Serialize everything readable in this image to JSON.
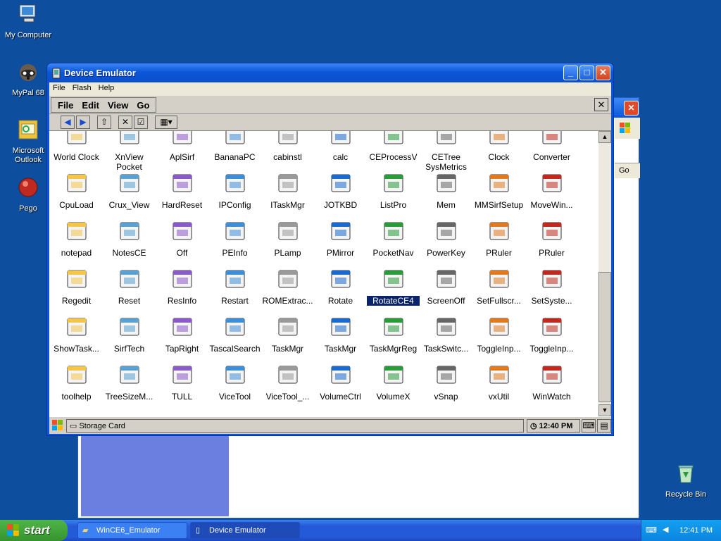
{
  "desktop": {
    "icons": [
      {
        "label": "My Computer"
      },
      {
        "label": "MyPal 68"
      },
      {
        "label": "Microsoft Outlook"
      },
      {
        "label": "Pego"
      },
      {
        "label": "Recycle Bin"
      }
    ]
  },
  "bg_window": {
    "tab_text": "Go"
  },
  "window": {
    "title": "Device Emulator",
    "menu": [
      "File",
      "Flash",
      "Help"
    ],
    "buttons": {
      "minimize": "_",
      "maximize": "□",
      "close": "✕"
    }
  },
  "device": {
    "menu": [
      "File",
      "Edit",
      "View",
      "Go"
    ],
    "close": "✕",
    "files": [
      "World Clock",
      "XnView Pocket",
      "AplSirf",
      "BananaPC",
      "cabinstl",
      "calc",
      "CEProcessV",
      "CETree SysMetrics",
      "Clock",
      "Converter",
      "CpuLoad",
      "Crux_View",
      "HardReset",
      "IPConfig",
      "ITaskMgr",
      "JOTKBD",
      "ListPro",
      "Mem",
      "MMSirfSetup",
      "MoveWin...",
      "notepad",
      "NotesCE",
      "Off",
      "PEInfo",
      "PLamp",
      "PMirror",
      "PocketNav",
      "PowerKey",
      "PRuler",
      "PRuler",
      "Regedit",
      "Reset",
      "ResInfo",
      "Restart",
      "ROMExtrac...",
      "Rotate",
      "RotateCE4",
      "ScreenOff",
      "SetFullscr...",
      "SetSyste...",
      "ShowTask...",
      "SirfTech",
      "TapRight",
      "TascalSearch",
      "TaskMgr",
      "TaskMgr",
      "TaskMgrReg",
      "TaskSwitc...",
      "ToggleInp...",
      "ToggleInp...",
      "toolhelp",
      "TreeSizeM...",
      "TULL",
      "ViceTool",
      "ViceTool_...",
      "VolumeCtrl",
      "VolumeX",
      "vSnap",
      "vxUtil",
      "WinWatch"
    ],
    "selected_file": "RotateCE4",
    "address": "Storage Card",
    "clock": "12:40 PM"
  },
  "taskbar": {
    "start": "start",
    "items": [
      "WinCE6_Emulator",
      "Device Emulator"
    ],
    "time": "12:41 PM"
  },
  "colors": {
    "desktop": "#0d4f9e",
    "title": "#0a56d8",
    "selection": "#0a246a"
  }
}
